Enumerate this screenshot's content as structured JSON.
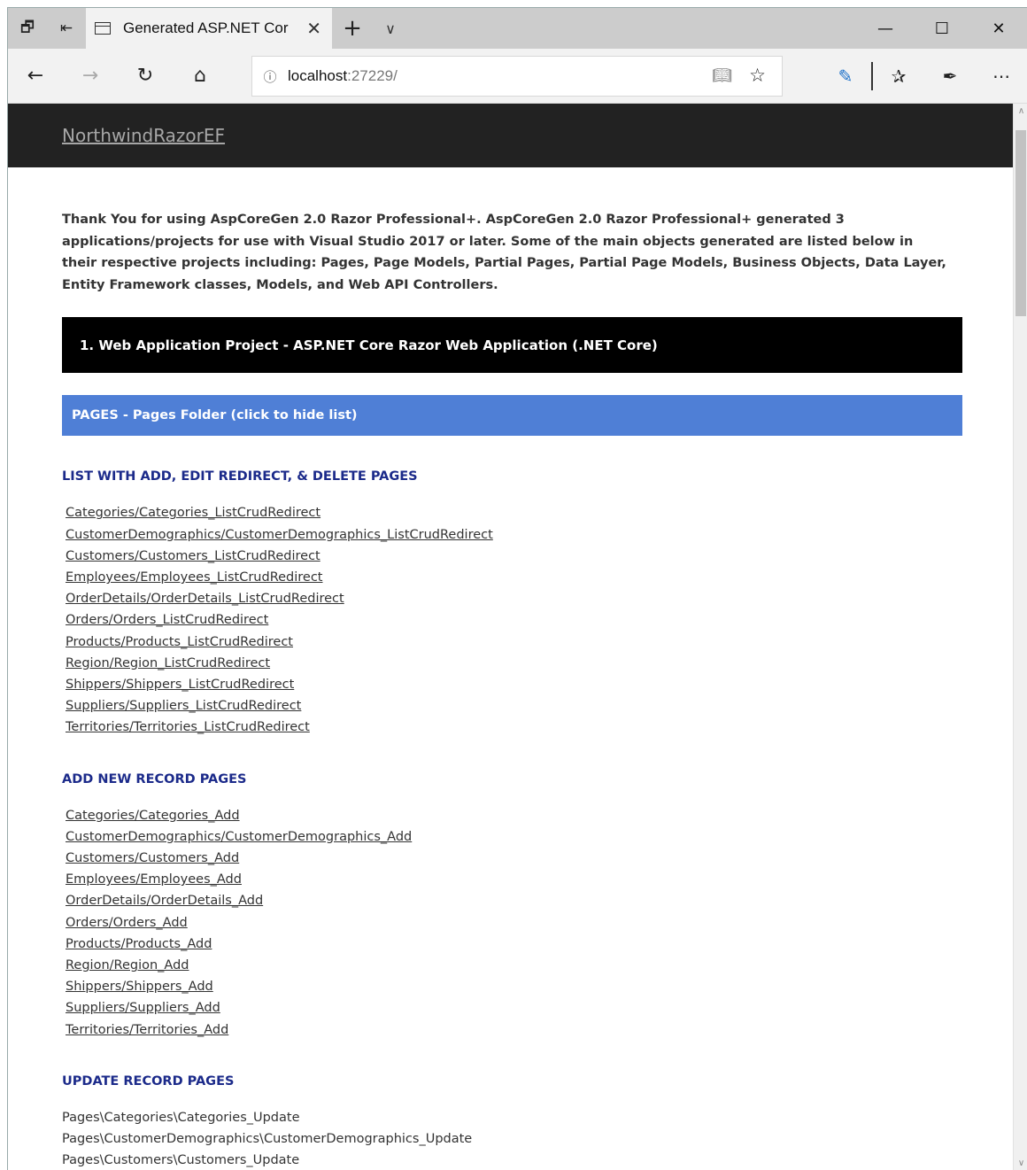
{
  "browser": {
    "tab_title": "Generated ASP.NET Cor",
    "address_host": "localhost",
    "address_port": ":27229/",
    "icons": [
      "tab-aside-icon",
      "tab-back-icon",
      "page-icon",
      "close-icon",
      "new-tab-icon",
      "chevron-down-icon",
      "minimize-icon",
      "maximize-icon",
      "close-window-icon",
      "back-icon",
      "forward-icon",
      "refresh-icon",
      "home-icon",
      "info-icon",
      "reading-view-icon",
      "favorite-star-icon",
      "extension-icon",
      "favorites-hub-icon",
      "pen-icon",
      "more-icon"
    ]
  },
  "site": {
    "brand": "NorthwindRazorEF",
    "intro": "Thank You for using AspCoreGen 2.0 Razor Professional+. AspCoreGen 2.0 Razor Professional+ generated 3 applications/projects for use with Visual Studio 2017 or later. Some of the main objects generated are listed below in their respective projects including: Pages, Page Models, Partial Pages, Partial Page Models, Business Objects, Data Layer, Entity Framework classes, Models, and Web API Controllers.",
    "project_bar": "1. Web Application Project - ASP.NET Core Razor Web Application (.NET Core)",
    "pages_bar": "PAGES - Pages Folder (click to hide list)"
  },
  "sections": {
    "list_crud": {
      "heading": "LIST WITH ADD, EDIT REDIRECT, & DELETE PAGES",
      "links": [
        "Categories/Categories_ListCrudRedirect",
        "CustomerDemographics/CustomerDemographics_ListCrudRedirect",
        "Customers/Customers_ListCrudRedirect",
        "Employees/Employees_ListCrudRedirect",
        "OrderDetails/OrderDetails_ListCrudRedirect",
        "Orders/Orders_ListCrudRedirect",
        "Products/Products_ListCrudRedirect",
        "Region/Region_ListCrudRedirect",
        "Shippers/Shippers_ListCrudRedirect",
        "Suppliers/Suppliers_ListCrudRedirect",
        "Territories/Territories_ListCrudRedirect"
      ]
    },
    "add_new": {
      "heading": "ADD NEW RECORD PAGES",
      "links": [
        "Categories/Categories_Add",
        "CustomerDemographics/CustomerDemographics_Add",
        "Customers/Customers_Add",
        "Employees/Employees_Add",
        "OrderDetails/OrderDetails_Add",
        "Orders/Orders_Add",
        "Products/Products_Add",
        "Region/Region_Add",
        "Shippers/Shippers_Add",
        "Suppliers/Suppliers_Add",
        "Territories/Territories_Add"
      ]
    },
    "update": {
      "heading": "UPDATE RECORD PAGES",
      "items": [
        "Pages\\Categories\\Categories_Update",
        "Pages\\CustomerDemographics\\CustomerDemographics_Update",
        "Pages\\Customers\\Customers_Update"
      ]
    }
  }
}
